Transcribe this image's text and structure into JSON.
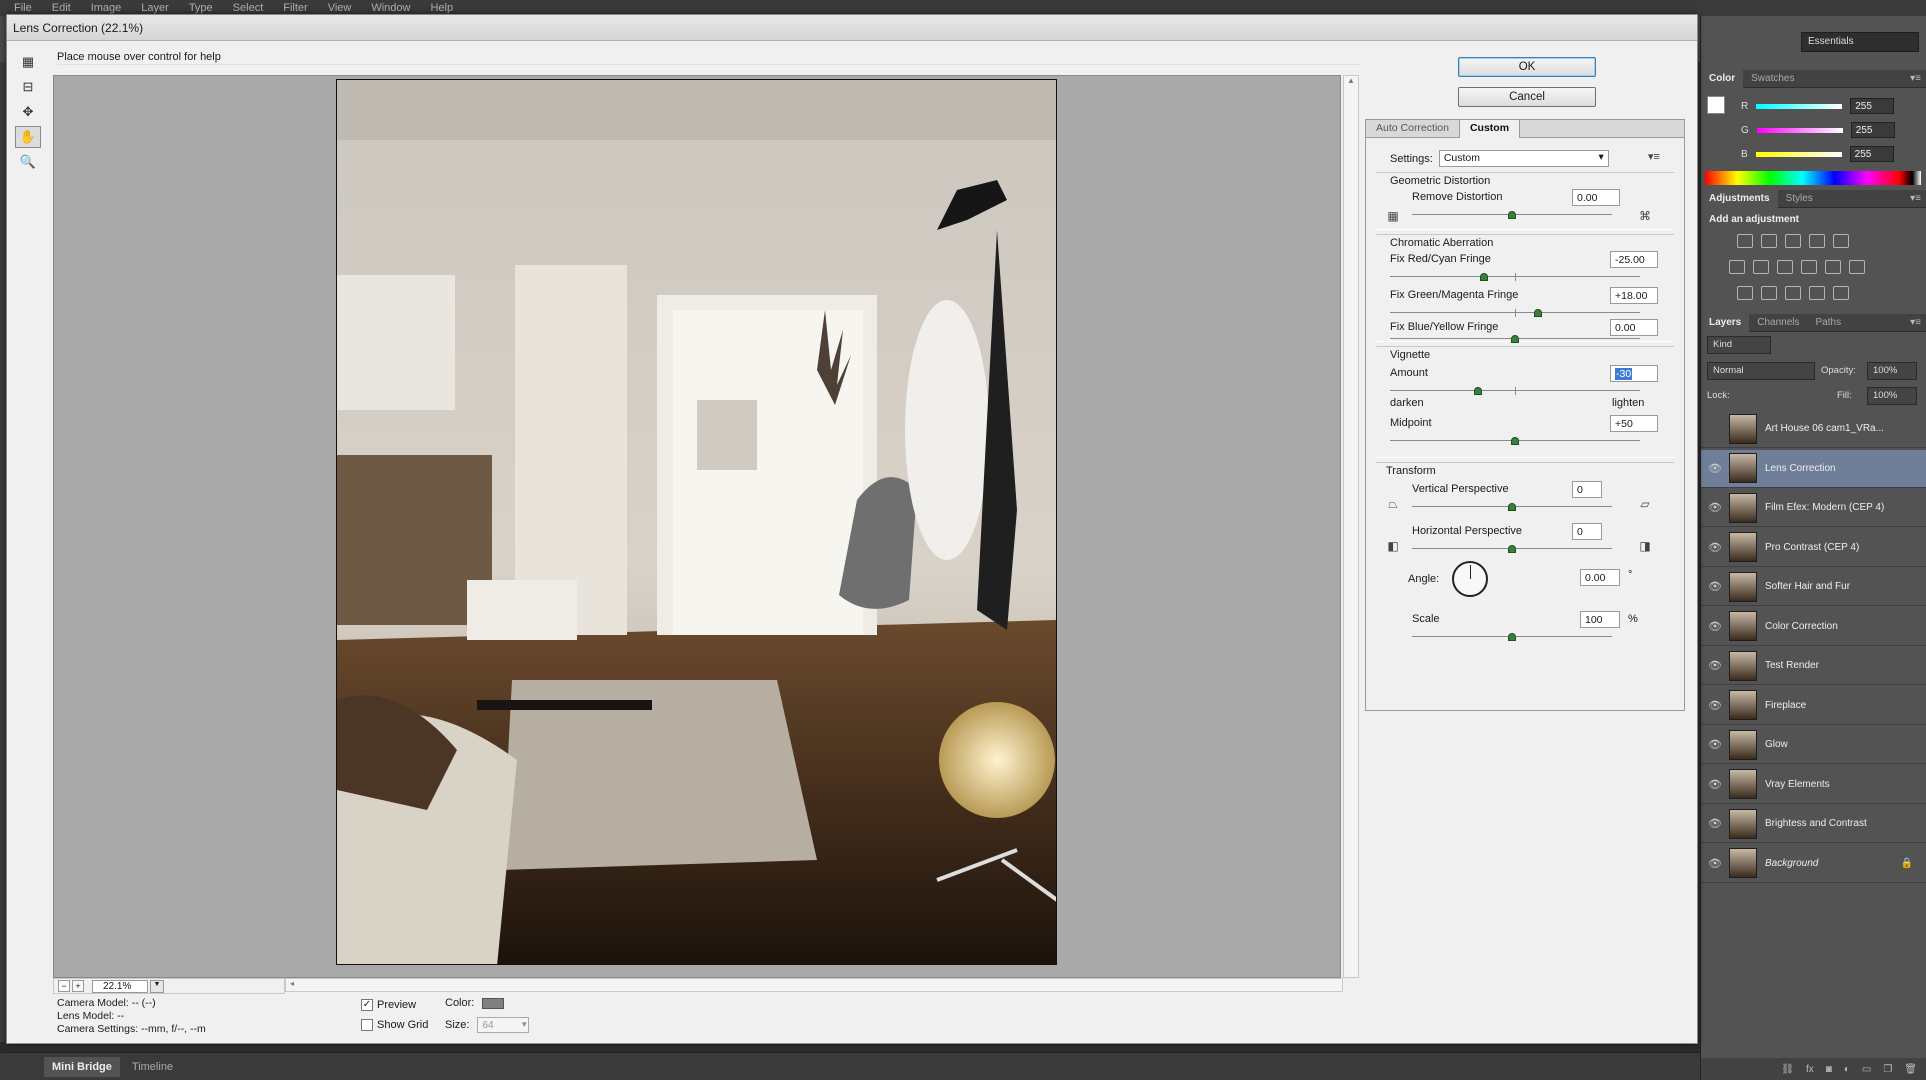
{
  "ps": {
    "menu": [
      "File",
      "Edit",
      "Image",
      "Layer",
      "Type",
      "Select",
      "Filter",
      "View",
      "Window",
      "Help"
    ],
    "workspace": "Essentials",
    "bottom_tabs": [
      "Mini Bridge",
      "Timeline"
    ]
  },
  "color_panel": {
    "tabs": [
      "Color",
      "Swatches"
    ],
    "r_label": "R",
    "g_label": "G",
    "b_label": "B",
    "r": "255",
    "g": "255",
    "b": "255"
  },
  "adjustments_panel": {
    "tabs": [
      "Adjustments",
      "Styles"
    ],
    "add_label": "Add an adjustment"
  },
  "layers_panel": {
    "tabs": [
      "Layers",
      "Channels",
      "Paths"
    ],
    "kind": "Kind",
    "blend_mode": "Normal",
    "opacity_label": "Opacity:",
    "opacity": "100%",
    "lock_label": "Lock:",
    "fill_label": "Fill:",
    "fill": "100%",
    "layers": [
      {
        "name": "Art House 06 cam1_VRa...",
        "visible": false,
        "selected": false
      },
      {
        "name": "Lens Correction",
        "visible": true,
        "selected": true
      },
      {
        "name": "Film Efex: Modern (CEP 4)",
        "visible": true,
        "selected": false
      },
      {
        "name": "Pro Contrast (CEP 4)",
        "visible": true,
        "selected": false
      },
      {
        "name": "Softer Hair and Fur",
        "visible": true,
        "selected": false
      },
      {
        "name": "Color Correction",
        "visible": true,
        "selected": false
      },
      {
        "name": "Test Render",
        "visible": true,
        "selected": false
      },
      {
        "name": "Fireplace",
        "visible": true,
        "selected": false
      },
      {
        "name": "Glow",
        "visible": true,
        "selected": false
      },
      {
        "name": "Vray Elements",
        "visible": true,
        "selected": false
      },
      {
        "name": "Brightess and Contrast",
        "visible": true,
        "selected": false
      },
      {
        "name": "Background",
        "visible": true,
        "selected": false
      }
    ]
  },
  "dialog": {
    "title": "Lens Correction (22.1%)",
    "help": "Place mouse over control for help",
    "ok": "OK",
    "cancel": "Cancel",
    "zoom": "22.1%",
    "camera_model": "Camera Model: -- (--)",
    "lens_model": "Lens Model: --",
    "camera_settings": "Camera Settings: --mm, f/--, --m",
    "preview_label": "Preview",
    "preview_checked": true,
    "show_grid_label": "Show Grid",
    "show_grid_checked": false,
    "color_label": "Color:",
    "size_label": "Size:",
    "size_value": "64",
    "tabs": [
      "Auto Correction",
      "Custom"
    ],
    "settings_label": "Settings:",
    "settings_value": "Custom",
    "geometric": {
      "title": "Geometric Distortion",
      "remove_label": "Remove Distortion",
      "remove_value": "0.00",
      "remove_pos": 0.5
    },
    "chromatic": {
      "title": "Chromatic Aberration",
      "red_label": "Fix Red/Cyan Fringe",
      "red_value": "-25.00",
      "red_pos": 0.375,
      "green_label": "Fix Green/Magenta Fringe",
      "green_value": "+18.00",
      "green_pos": 0.59,
      "blue_label": "Fix Blue/Yellow Fringe",
      "blue_value": "0.00",
      "blue_pos": 0.5
    },
    "vignette": {
      "title": "Vignette",
      "amount_label": "Amount",
      "amount_value": "-30",
      "amount_pos": 0.35,
      "darken": "darken",
      "lighten": "lighten",
      "midpoint_label": "Midpoint",
      "midpoint_value": "+50",
      "midpoint_pos": 0.5
    },
    "transform": {
      "title": "Transform",
      "vertical_label": "Vertical Perspective",
      "vertical_value": "0",
      "vertical_pos": 0.5,
      "horizontal_label": "Horizontal Perspective",
      "horizontal_value": "0",
      "horizontal_pos": 0.5,
      "angle_label": "Angle:",
      "angle_value": "0.00",
      "angle_unit": "°",
      "scale_label": "Scale",
      "scale_value": "100",
      "scale_unit": "%",
      "scale_pos": 0.5
    }
  }
}
